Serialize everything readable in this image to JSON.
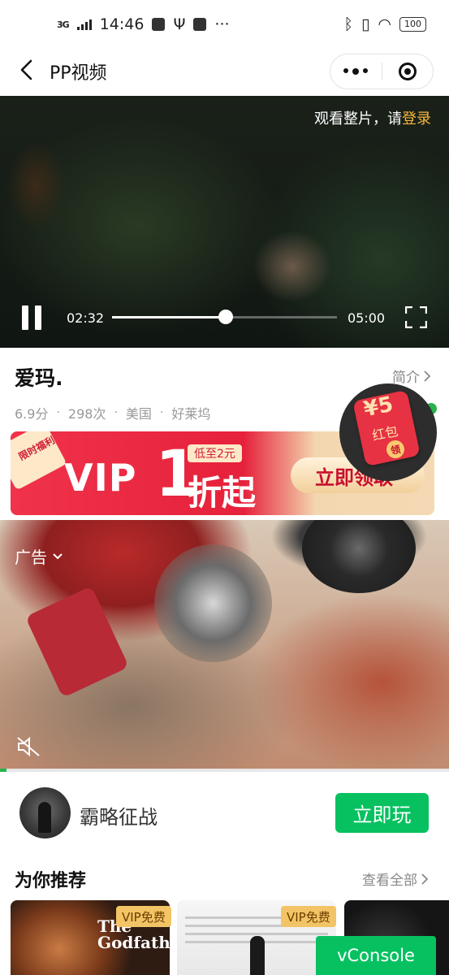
{
  "status_bar": {
    "network": "3G",
    "time": "14:46",
    "battery": "100"
  },
  "header": {
    "title": "PP视频",
    "back_icon": "chevron-left-icon",
    "more_icon": "more-dots-icon",
    "close_icon": "target-circle-icon"
  },
  "player": {
    "login_hint_prefix": "观看整片，请",
    "login_link": "登录",
    "current_time": "02:32",
    "duration": "05:00",
    "progress": 0.507
  },
  "movie": {
    "title": "爱玛.",
    "intro_link": "简介",
    "score": "6.9分",
    "views": "298次",
    "region": "美国",
    "origin": "好莱坞",
    "separator": "·"
  },
  "vip_banner": {
    "corner_tag": "限时福利",
    "vip": "VIP",
    "one": "1",
    "low_price": "低至2元",
    "fold": "折起",
    "button": "立即领取"
  },
  "red_packet": {
    "amount": "¥5",
    "label": "红包",
    "claim": "领"
  },
  "ad": {
    "tag": "广告"
  },
  "game": {
    "name": "霸略征战",
    "play_button": "立即玩"
  },
  "recommend": {
    "title": "为你推荐",
    "view_all": "查看全部",
    "items": [
      {
        "badge": "VIP免费",
        "poster_text": "The Godfather"
      },
      {
        "badge": "VIP免费"
      }
    ]
  },
  "vconsole": "vConsole",
  "colors": {
    "accent_green": "#07c160",
    "login_orange": "#f6b73c",
    "vip_red": "#e6213b",
    "vip_badge": "#f3c465"
  }
}
